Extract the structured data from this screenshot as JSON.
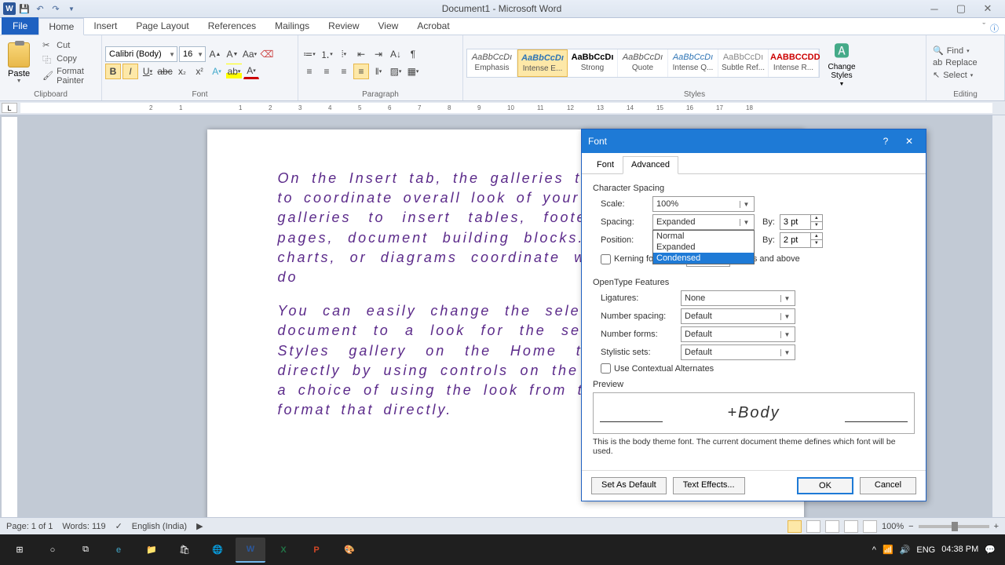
{
  "titlebar": {
    "doc_title": "Document1 - Microsoft Word"
  },
  "tabs": {
    "file": "File",
    "list": [
      "Home",
      "Insert",
      "Page Layout",
      "References",
      "Mailings",
      "Review",
      "View",
      "Acrobat"
    ],
    "active": "Home"
  },
  "ribbon": {
    "clipboard": {
      "paste": "Paste",
      "cut": "Cut",
      "copy": "Copy",
      "format_painter": "Format Painter",
      "label": "Clipboard"
    },
    "font": {
      "name": "Calibri (Body)",
      "size": "16",
      "label": "Font"
    },
    "paragraph": {
      "label": "Paragraph"
    },
    "styles": {
      "label": "Styles",
      "items": [
        {
          "preview": "AaBbCcDı",
          "name": "Emphasis",
          "cls": "emph"
        },
        {
          "preview": "AaBbCcDı",
          "name": "Intense E...",
          "cls": "intense",
          "sel": true
        },
        {
          "preview": "AaBbCcDı",
          "name": "Strong",
          "cls": "strong"
        },
        {
          "preview": "AaBbCcDı",
          "name": "Quote",
          "cls": "quote"
        },
        {
          "preview": "AaBbCcDı",
          "name": "Intense Q...",
          "cls": "iquote"
        },
        {
          "preview": "AaBbCcDı",
          "name": "Subtle Ref...",
          "cls": "sref"
        },
        {
          "preview": "AABBCCDD",
          "name": "Intense R...",
          "cls": "iref"
        }
      ],
      "change": "Change Styles"
    },
    "editing": {
      "find": "Find",
      "replace": "Replace",
      "select": "Select",
      "label": "Editing"
    }
  },
  "document": {
    "p1": "On the Insert tab, the galleries that are designed to coordinate overall look of your document. these galleries to insert tables, footers, lists, cover pages, document building blocks. When pictures, charts, or diagrams coordinate with your current do",
    "p2": "You can easily change the selected text in the document to a look for the selected text from Styles gallery on the Home tab. format text directly by using controls on the Home tab. Most a choice of using the look from theme or using a format that directly."
  },
  "dialog": {
    "title": "Font",
    "tabs": [
      "Font",
      "Advanced"
    ],
    "active_tab": "Advanced",
    "char_spacing": {
      "label": "Character Spacing",
      "scale_label": "Scale:",
      "scale": "100%",
      "spacing_label": "Spacing:",
      "spacing": "Expanded",
      "spacing_by_label": "By:",
      "spacing_by": "3 pt",
      "position_label": "Position:",
      "position_by_label": "By:",
      "position_by": "2 pt",
      "dropdown_options": [
        "Normal",
        "Expanded",
        "Condensed"
      ],
      "dropdown_selected": "Condensed",
      "kerning_label": "Kerning for fonts:",
      "kerning_suffix": "Points and above"
    },
    "opentype": {
      "label": "OpenType Features",
      "ligatures_label": "Ligatures:",
      "ligatures": "None",
      "numspacing_label": "Number spacing:",
      "numspacing": "Default",
      "numforms_label": "Number forms:",
      "numforms": "Default",
      "stylistic_label": "Stylistic sets:",
      "stylistic": "Default",
      "contextual_label": "Use Contextual Alternates"
    },
    "preview": {
      "label": "Preview",
      "text": "+Body",
      "desc": "This is the body theme font. The current document theme defines which font will be used."
    },
    "buttons": {
      "default": "Set As Default",
      "effects": "Text Effects...",
      "ok": "OK",
      "cancel": "Cancel"
    }
  },
  "status": {
    "page": "Page: 1 of 1",
    "words": "Words: 119",
    "lang": "English (India)",
    "zoom": "100%"
  },
  "taskbar": {
    "lang": "ENG",
    "time": "04:38 PM"
  }
}
